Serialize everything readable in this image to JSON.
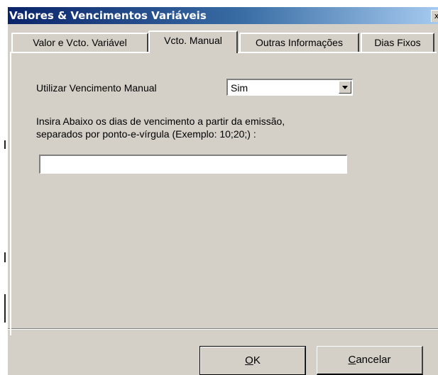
{
  "window": {
    "title": "Valores & Vencimentos Variáveis",
    "close_glyph": "x"
  },
  "tabs": [
    {
      "label": "Valor e Vcto. Variável",
      "active": false
    },
    {
      "label": "Vcto. Manual",
      "active": true
    },
    {
      "label": "Outras Informações",
      "active": false
    },
    {
      "label": "Dias Fixos",
      "active": false
    }
  ],
  "manual": {
    "use_label": "Utilizar Vencimento Manual",
    "use_value": "Sim",
    "instructions_line1": "Insira Abaixo os dias de vencimento a partir da emissão,",
    "instructions_line2": "separados por ponto-e-vírgula (Exemplo: 10;20;) :",
    "days_value": ""
  },
  "buttons": {
    "ok_mnemonic": "O",
    "ok_rest": "K",
    "cancel_mnemonic": "C",
    "cancel_rest": "ancelar"
  },
  "colors": {
    "title_start": "#0a246a",
    "title_end": "#a6caf0",
    "face": "#d4d0c8"
  }
}
